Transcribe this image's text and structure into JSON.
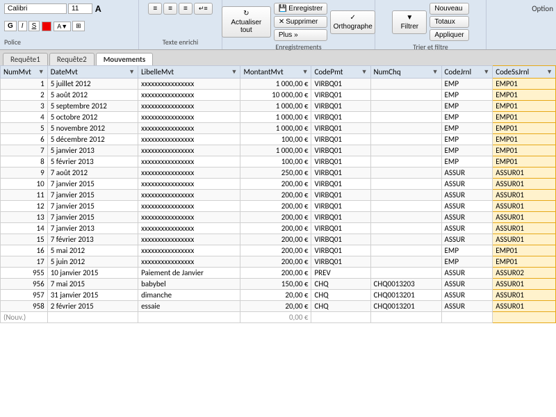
{
  "ribbon": {
    "font_name": "Calibri",
    "font_size": "11",
    "sections": [
      "Police",
      "Texte enrichi",
      "Enregistrements",
      "Trier et filtre"
    ],
    "buttons": {
      "actualiser": "Actualiser tout",
      "enregistrer": "Enregistrer",
      "supprimer": "Supprimer",
      "orthographe": "Orthographe",
      "plus": "Plus »",
      "filtrer": "Filtrer",
      "nouveau": "Nouveau",
      "totaux": "Totaux",
      "appliquer": "Appliquer"
    }
  },
  "tabs": [
    {
      "id": "requete1",
      "label": "Requête1"
    },
    {
      "id": "requete2",
      "label": "Requête2"
    },
    {
      "id": "mouvements",
      "label": "Mouvements",
      "active": true
    }
  ],
  "columns": [
    {
      "id": "numMvt",
      "label": "NumMvt"
    },
    {
      "id": "dateMvt",
      "label": "DateMvt"
    },
    {
      "id": "libelleMvt",
      "label": "LibelleMvt"
    },
    {
      "id": "montantMvt",
      "label": "MontantMvt"
    },
    {
      "id": "codePmt",
      "label": "CodePmt"
    },
    {
      "id": "numChq",
      "label": "NumChq"
    },
    {
      "id": "codeJrnl",
      "label": "CodeJrnl"
    },
    {
      "id": "codeSsJrnl",
      "label": "CodeSsJrnl"
    }
  ],
  "rows": [
    {
      "num": "1",
      "date": "5 juillet 2012",
      "libelle": "xxxxxxxxxxxxxxxx",
      "montant": "1 000,00 €",
      "codePmt": "VIRBQ01",
      "numChq": "",
      "codeJrnl": "EMP",
      "codeSsJrnl": "EMP01"
    },
    {
      "num": "2",
      "date": "5 août 2012",
      "libelle": "xxxxxxxxxxxxxxxx",
      "montant": "10 000,00 €",
      "codePmt": "VIRBQ01",
      "numChq": "",
      "codeJrnl": "EMP",
      "codeSsJrnl": "EMP01"
    },
    {
      "num": "3",
      "date": "5 septembre 2012",
      "libelle": "xxxxxxxxxxxxxxxx",
      "montant": "1 000,00 €",
      "codePmt": "VIRBQ01",
      "numChq": "",
      "codeJrnl": "EMP",
      "codeSsJrnl": "EMP01"
    },
    {
      "num": "4",
      "date": "5 octobre 2012",
      "libelle": "xxxxxxxxxxxxxxxx",
      "montant": "1 000,00 €",
      "codePmt": "VIRBQ01",
      "numChq": "",
      "codeJrnl": "EMP",
      "codeSsJrnl": "EMP01"
    },
    {
      "num": "5",
      "date": "5 novembre 2012",
      "libelle": "xxxxxxxxxxxxxxxx",
      "montant": "1 000,00 €",
      "codePmt": "VIRBQ01",
      "numChq": "",
      "codeJrnl": "EMP",
      "codeSsJrnl": "EMP01"
    },
    {
      "num": "6",
      "date": "5 décembre 2012",
      "libelle": "xxxxxxxxxxxxxxxx",
      "montant": "100,00 €",
      "codePmt": "VIRBQ01",
      "numChq": "",
      "codeJrnl": "EMP",
      "codeSsJrnl": "EMP01"
    },
    {
      "num": "7",
      "date": "5 janvier 2013",
      "libelle": "xxxxxxxxxxxxxxxx",
      "montant": "1 000,00 €",
      "codePmt": "VIRBQ01",
      "numChq": "",
      "codeJrnl": "EMP",
      "codeSsJrnl": "EMP01"
    },
    {
      "num": "8",
      "date": "5 février 2013",
      "libelle": "xxxxxxxxxxxxxxxx",
      "montant": "100,00 €",
      "codePmt": "VIRBQ01",
      "numChq": "",
      "codeJrnl": "EMP",
      "codeSsJrnl": "EMP01"
    },
    {
      "num": "9",
      "date": "7 août 2012",
      "libelle": "xxxxxxxxxxxxxxxx",
      "montant": "250,00 €",
      "codePmt": "VIRBQ01",
      "numChq": "",
      "codeJrnl": "ASSUR",
      "codeSsJrnl": "ASSUR01"
    },
    {
      "num": "10",
      "date": "7 janvier 2015",
      "libelle": "xxxxxxxxxxxxxxxx",
      "montant": "200,00 €",
      "codePmt": "VIRBQ01",
      "numChq": "",
      "codeJrnl": "ASSUR",
      "codeSsJrnl": "ASSUR01"
    },
    {
      "num": "11",
      "date": "7 janvier 2015",
      "libelle": "xxxxxxxxxxxxxxxx",
      "montant": "200,00 €",
      "codePmt": "VIRBQ01",
      "numChq": "",
      "codeJrnl": "ASSUR",
      "codeSsJrnl": "ASSUR01"
    },
    {
      "num": "12",
      "date": "7 janvier 2015",
      "libelle": "xxxxxxxxxxxxxxxx",
      "montant": "200,00 €",
      "codePmt": "VIRBQ01",
      "numChq": "",
      "codeJrnl": "ASSUR",
      "codeSsJrnl": "ASSUR01"
    },
    {
      "num": "13",
      "date": "7 janvier 2015",
      "libelle": "xxxxxxxxxxxxxxxx",
      "montant": "200,00 €",
      "codePmt": "VIRBQ01",
      "numChq": "",
      "codeJrnl": "ASSUR",
      "codeSsJrnl": "ASSUR01"
    },
    {
      "num": "14",
      "date": "7 janvier 2013",
      "libelle": "xxxxxxxxxxxxxxxx",
      "montant": "200,00 €",
      "codePmt": "VIRBQ01",
      "numChq": "",
      "codeJrnl": "ASSUR",
      "codeSsJrnl": "ASSUR01"
    },
    {
      "num": "15",
      "date": "7 février 2013",
      "libelle": "xxxxxxxxxxxxxxxx",
      "montant": "200,00 €",
      "codePmt": "VIRBQ01",
      "numChq": "",
      "codeJrnl": "ASSUR",
      "codeSsJrnl": "ASSUR01"
    },
    {
      "num": "16",
      "date": "5 mai 2012",
      "libelle": "xxxxxxxxxxxxxxxx",
      "montant": "200,00 €",
      "codePmt": "VIRBQ01",
      "numChq": "",
      "codeJrnl": "EMP",
      "codeSsJrnl": "EMP01"
    },
    {
      "num": "17",
      "date": "5 juin 2012",
      "libelle": "xxxxxxxxxxxxxxxx",
      "montant": "200,00 €",
      "codePmt": "VIRBQ01",
      "numChq": "",
      "codeJrnl": "EMP",
      "codeSsJrnl": "EMP01"
    },
    {
      "num": "955",
      "date": "10 janvier 2015",
      "libelle": "Paiement de Janvier",
      "montant": "200,00 €",
      "codePmt": "PREV",
      "numChq": "",
      "codeJrnl": "ASSUR",
      "codeSsJrnl": "ASSUR02"
    },
    {
      "num": "956",
      "date": "7 mai 2015",
      "libelle": "babybel",
      "montant": "150,00 €",
      "codePmt": "CHQ",
      "numChq": "CHQ0013203",
      "codeJrnl": "ASSUR",
      "codeSsJrnl": "ASSUR01"
    },
    {
      "num": "957",
      "date": "31 janvier 2015",
      "libelle": "dimanche",
      "montant": "20,00 €",
      "codePmt": "CHQ",
      "numChq": "CHQ0013201",
      "codeJrnl": "ASSUR",
      "codeSsJrnl": "ASSUR01"
    },
    {
      "num": "958",
      "date": "2 février 2015",
      "libelle": "essaie",
      "montant": "20,00 €",
      "codePmt": "CHQ",
      "numChq": "CHQ0013201",
      "codeJrnl": "ASSUR",
      "codeSsJrnl": "ASSUR01"
    }
  ],
  "new_row": {
    "label": "(Nouv.)",
    "montant": "0,00 €"
  },
  "option_label": "Option"
}
